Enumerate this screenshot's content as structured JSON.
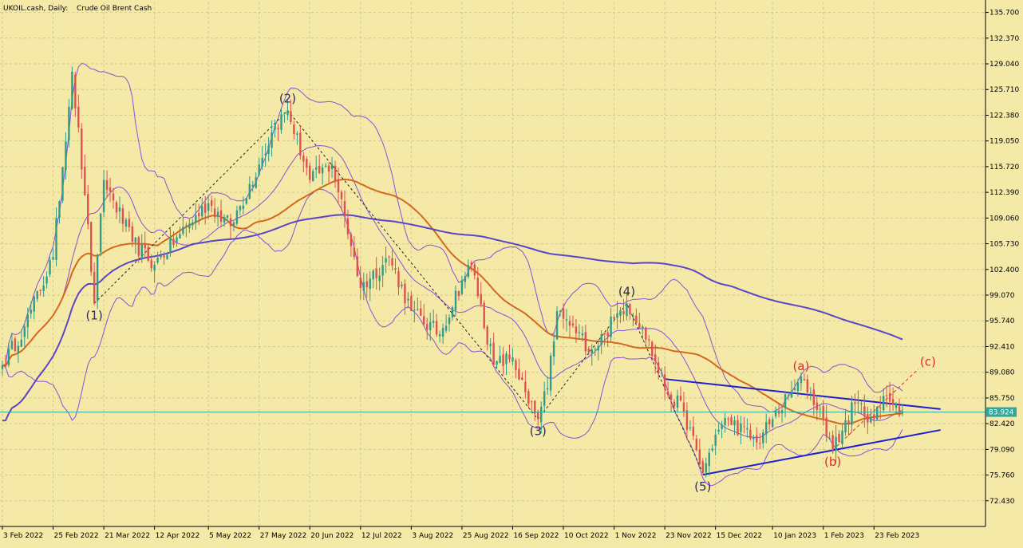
{
  "header": {
    "symbol_timeframe": "UKOIL.cash, Daily:",
    "instrument_name": "Crude Oil Brent Cash"
  },
  "colors": {
    "background": "#F5E9A7",
    "grid": "#D2C88A",
    "bull_candle": "#2E9C8A",
    "bear_candle": "#E0504F",
    "bollinger_band": "#8A4FD8",
    "ma_50": "#D2691E",
    "ma_200": "#5A45C8",
    "triangle_lines": "#1E1ED2",
    "price_line": "#2FA89C",
    "wave_labels": "#2E2E55",
    "abc_labels": "#E02A2A"
  },
  "chart_data": {
    "type": "candlestick",
    "title": "UKOIL.cash, Daily:  Crude Oil Brent Cash",
    "ylim": [
      69.1,
      137.0
    ],
    "y_ticks": [
      "135.700",
      "132.370",
      "129.040",
      "125.710",
      "122.380",
      "119.050",
      "115.720",
      "112.390",
      "109.060",
      "105.730",
      "102.400",
      "99.070",
      "95.740",
      "92.410",
      "89.080",
      "85.750",
      "82.420",
      "79.090",
      "75.760",
      "72.430"
    ],
    "x_ticks": [
      "3 Feb 2022",
      "25 Feb 2022",
      "21 Mar 2022",
      "12 Apr 2022",
      "5 May 2022",
      "27 May 2022",
      "20 Jun 2022",
      "12 Jul 2022",
      "3 Aug 2022",
      "25 Aug 2022",
      "16 Sep 2022",
      "10 Oct 2022",
      "1 Nov 2022",
      "23 Nov 2022",
      "15 Dec 2022",
      "10 Jan 2023",
      "1 Feb 2023",
      "23 Feb 2023"
    ],
    "current_price": "83.924",
    "price_path": [
      [
        "3 Feb 2022",
        90
      ],
      [
        "14 Feb 2022",
        95
      ],
      [
        "25 Feb 2022",
        104
      ],
      [
        "7 Mar 2022",
        128
      ],
      [
        "11 Mar 2022",
        112
      ],
      [
        "16 Mar 2022",
        98
      ],
      [
        "21 Mar 2022",
        114
      ],
      [
        "1 Apr 2022",
        106
      ],
      [
        "12 Apr 2022",
        103
      ],
      [
        "22 Apr 2022",
        107
      ],
      [
        "5 May 2022",
        111
      ],
      [
        "16 May 2022",
        108
      ],
      [
        "27 May 2022",
        116
      ],
      [
        "3 Jun 2022",
        121
      ],
      [
        "9 Jun 2022",
        123
      ],
      [
        "20 Jun 2022",
        114
      ],
      [
        "29 Jun 2022",
        116
      ],
      [
        "8 Jul 2022",
        104
      ],
      [
        "12 Jul 2022",
        100
      ],
      [
        "25 Jul 2022",
        104
      ],
      [
        "3 Aug 2022",
        97
      ],
      [
        "16 Aug 2022",
        94
      ],
      [
        "25 Aug 2022",
        101
      ],
      [
        "30 Aug 2022",
        103
      ],
      [
        "8 Sep 2022",
        90
      ],
      [
        "16 Sep 2022",
        91
      ],
      [
        "23 Sep 2022",
        85
      ],
      [
        "28 Sep 2022",
        83
      ],
      [
        "3 Oct 2022",
        87
      ],
      [
        "6 Oct 2022",
        97
      ],
      [
        "10 Oct 2022",
        96
      ],
      [
        "21 Oct 2022",
        92
      ],
      [
        "27 Oct 2022",
        94
      ],
      [
        "1 Nov 2022",
        96
      ],
      [
        "7 Nov 2022",
        98
      ],
      [
        "14 Nov 2022",
        95
      ],
      [
        "23 Nov 2022",
        87
      ],
      [
        "1 Dec 2022",
        84
      ],
      [
        "9 Dec 2022",
        76
      ],
      [
        "15 Dec 2022",
        81
      ],
      [
        "21 Dec 2022",
        83
      ],
      [
        "3 Jan 2023",
        80
      ],
      [
        "10 Jan 2023",
        83
      ],
      [
        "19 Jan 2023",
        87
      ],
      [
        "24 Jan 2023",
        88
      ],
      [
        "1 Feb 2023",
        83
      ],
      [
        "6 Feb 2023",
        79
      ],
      [
        "15 Feb 2023",
        85
      ],
      [
        "23 Feb 2023",
        83
      ],
      [
        "1 Mar 2023",
        86
      ],
      [
        "6 Mar 2023",
        85
      ],
      [
        "8 Mar 2023",
        84
      ]
    ],
    "annotations": {
      "wave_labels": [
        "(1)",
        "(2)",
        "(3)",
        "(4)",
        "(5)"
      ],
      "correction_labels": [
        "(a)",
        "(b)",
        "(c)"
      ]
    }
  }
}
